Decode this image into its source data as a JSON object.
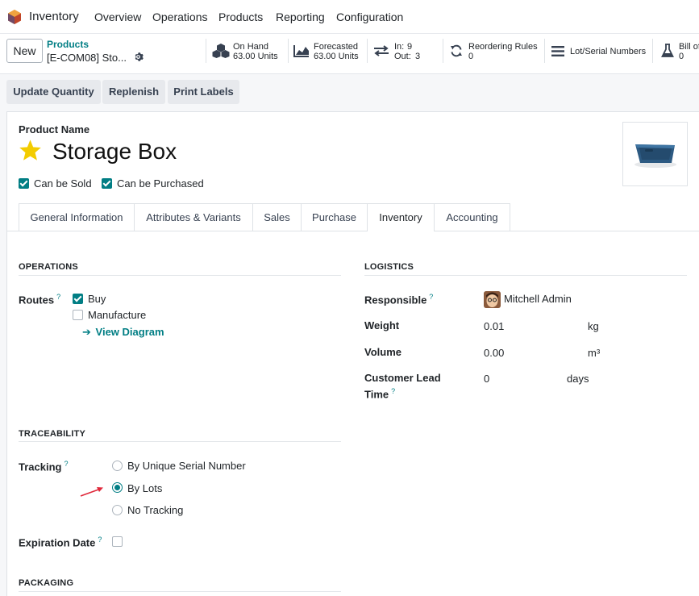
{
  "app": {
    "name": "Inventory"
  },
  "menu": [
    "Overview",
    "Operations",
    "Products",
    "Reporting",
    "Configuration"
  ],
  "control": {
    "new_label": "New",
    "breadcrumb_parent": "Products",
    "breadcrumb_current": "[E-COM08] Sto...",
    "stats": {
      "on_hand_label": "On Hand",
      "on_hand_value": "63.00 Units",
      "forecasted_label": "Forecasted",
      "forecasted_value": "63.00 Units",
      "in_label": "In:",
      "in_value": "9",
      "out_label": "Out:",
      "out_value": "3",
      "reordering_label": "Reordering Rules",
      "reordering_value": "0",
      "lot_serial_label": "Lot/Serial Numbers",
      "bom_label": "Bill of",
      "bom_value": "0"
    }
  },
  "actions": [
    "Update Quantity",
    "Replenish",
    "Print Labels"
  ],
  "product": {
    "name_label": "Product Name",
    "name": "Storage Box",
    "can_be_sold_label": "Can be Sold",
    "can_be_sold": true,
    "can_be_purchased_label": "Can be Purchased",
    "can_be_purchased": true,
    "favorite": true
  },
  "tabs": [
    "General Information",
    "Attributes & Variants",
    "Sales",
    "Purchase",
    "Inventory",
    "Accounting"
  ],
  "active_tab": "Inventory",
  "operations": {
    "title": "OPERATIONS",
    "routes_label": "Routes",
    "routes": [
      {
        "label": "Buy",
        "checked": true
      },
      {
        "label": "Manufacture",
        "checked": false
      }
    ],
    "view_diagram": "View Diagram"
  },
  "logistics": {
    "title": "LOGISTICS",
    "responsible_label": "Responsible",
    "responsible_value": "Mitchell Admin",
    "weight_label": "Weight",
    "weight_value": "0.01",
    "weight_unit": "kg",
    "volume_label": "Volume",
    "volume_value": "0.00",
    "volume_unit": "m³",
    "lead_time_label_1": "Customer Lead",
    "lead_time_label_2": "Time",
    "lead_time_value": "0",
    "lead_time_unit": "days"
  },
  "traceability": {
    "title": "TRACEABILITY",
    "tracking_label": "Tracking",
    "options": [
      {
        "label": "By Unique Serial Number",
        "selected": false
      },
      {
        "label": "By Lots",
        "selected": true
      },
      {
        "label": "No Tracking",
        "selected": false
      }
    ],
    "expiration_label": "Expiration Date",
    "expiration_checked": false
  },
  "packaging": {
    "title": "PACKAGING"
  },
  "colors": {
    "accent": "#017e84",
    "star": "#f3cc00",
    "brand": "#714b67",
    "arrow": "#e0283a"
  }
}
